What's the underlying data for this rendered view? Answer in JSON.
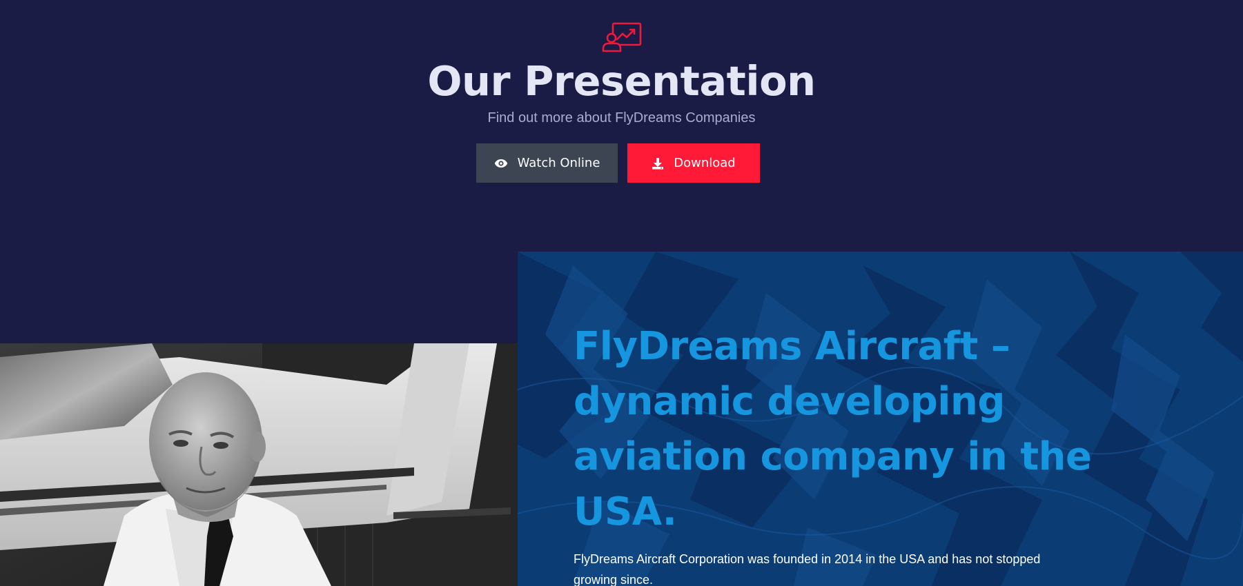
{
  "presentation": {
    "icon": "presentation-chart-icon",
    "title": "Our Presentation",
    "subtitle": "Find out more about FlyDreams Companies",
    "watch_button": {
      "label": "Watch Online",
      "icon": "eye-icon"
    },
    "download_button": {
      "label": "Download",
      "icon": "download-icon"
    }
  },
  "photo": {
    "description_icon": "pilot-photo"
  },
  "about": {
    "heading": "FlyDreams Aircraft – dynamic developing aviation company in the USA.",
    "text": "FlyDreams Aircraft Corporation was founded in 2014 in the USA and has not stopped growing since."
  },
  "colors": {
    "page_background": "#1b1c45",
    "accent_red": "#ff1a38",
    "watch_button": "#3d4552",
    "about_background": "#0b3c74",
    "about_heading": "#1796e0",
    "title_text": "#e4e6f5",
    "subtitle_text": "#a9aed0"
  }
}
